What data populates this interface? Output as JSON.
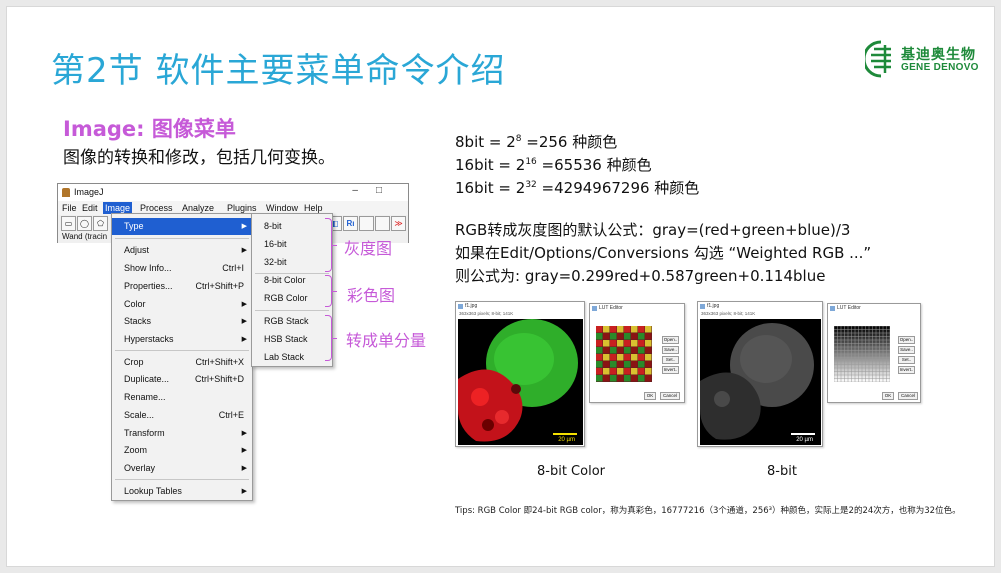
{
  "title": "第2节 软件主要菜单命令介绍",
  "logo": {
    "name_cn": "基迪奥生物",
    "name_en": "GENE DENOVO",
    "color": "#1e8a3a"
  },
  "subhead": "Image: 图像菜单",
  "subtext": "图像的转换和修改，包括几何变换。",
  "imagej": {
    "title": "ImageJ",
    "menubar": [
      "File",
      "Edit",
      "Image",
      "Process",
      "Analyze",
      "Plugins",
      "Window",
      "Help"
    ],
    "status": "Wand (tracin"
  },
  "image_menu": [
    {
      "label": "Type",
      "shortcut": "",
      "arrow": true
    },
    {
      "label": "Adjust",
      "shortcut": "",
      "arrow": true
    },
    {
      "label": "Show Info...",
      "shortcut": "Ctrl+I",
      "arrow": false
    },
    {
      "label": "Properties...",
      "shortcut": "Ctrl+Shift+P",
      "arrow": false
    },
    {
      "label": "Color",
      "shortcut": "",
      "arrow": true
    },
    {
      "label": "Stacks",
      "shortcut": "",
      "arrow": true
    },
    {
      "label": "Hyperstacks",
      "shortcut": "",
      "arrow": true
    },
    {
      "label": "Crop",
      "shortcut": "Ctrl+Shift+X",
      "arrow": false
    },
    {
      "label": "Duplicate...",
      "shortcut": "Ctrl+Shift+D",
      "arrow": false
    },
    {
      "label": "Rename...",
      "shortcut": "",
      "arrow": false
    },
    {
      "label": "Scale...",
      "shortcut": "Ctrl+E",
      "arrow": false
    },
    {
      "label": "Transform",
      "shortcut": "",
      "arrow": true
    },
    {
      "label": "Zoom",
      "shortcut": "",
      "arrow": true
    },
    {
      "label": "Overlay",
      "shortcut": "",
      "arrow": true
    },
    {
      "label": "Lookup Tables",
      "shortcut": "",
      "arrow": true
    }
  ],
  "type_menu": [
    "8-bit",
    "16-bit",
    "32-bit",
    "8-bit Color",
    "RGB Color",
    "RGB Stack",
    "HSB Stack",
    "Lab Stack"
  ],
  "callouts": {
    "gray": "灰度图",
    "color": "彩色图",
    "split": "转成单分量"
  },
  "bit_info": [
    {
      "prefix": "8bit = 2",
      "exp": "8",
      "suffix": " =256 种颜色"
    },
    {
      "prefix": "16bit = 2",
      "exp": "16",
      "suffix": " =65536 种颜色"
    },
    {
      "prefix": "16bit = 2",
      "exp": "32",
      "suffix": " =4294967296 种颜色"
    }
  ],
  "formula_lines": [
    "RGB转成灰度图的默认公式：gray=(red+green+blue)/3",
    "如果在Edit/Options/Conversions 勾选 “Weighted RGB ...”",
    "则公式为: gray=0.299red+0.587green+0.114blue"
  ],
  "panels": {
    "color_caption": "8-bit Color",
    "gray_caption": "8-bit",
    "scale_label": "20 µm",
    "lut_buttons": [
      "Open..",
      "Save..",
      "Set..",
      "Invert.."
    ],
    "ok": "OK",
    "cancel": "Cancel",
    "win_title": "f1.jpg",
    "win_sub": "363x363 pixels; 8-bit; 141K",
    "lut_title": "LUT Editor"
  },
  "tips": "Tips: RGB Color 即24-bit RGB color，称为真彩色，16777216（3个通道，256³）种颜色，实际上是2的24次方，也称为32位色。"
}
